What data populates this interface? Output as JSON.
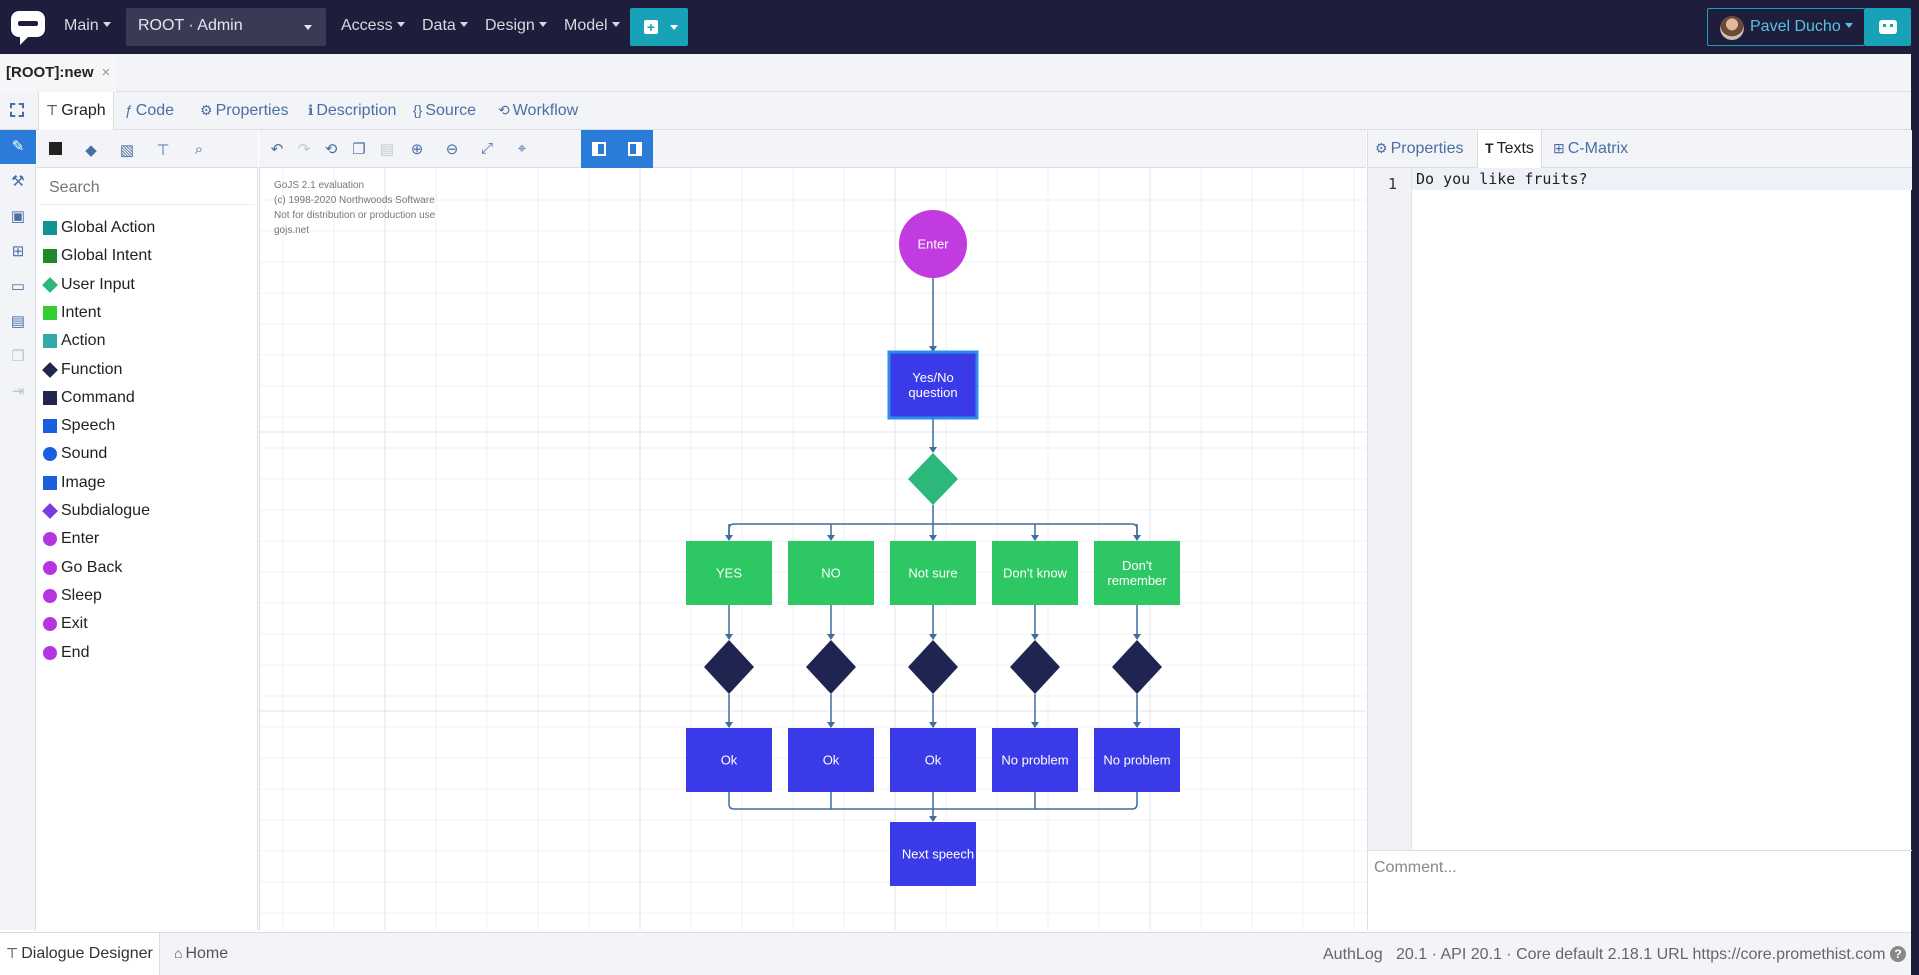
{
  "navbar": {
    "menus": [
      "Main",
      "Access",
      "Data",
      "Design",
      "Model"
    ],
    "root_selector": "ROOT · Admin",
    "user_name": "Pavel Ducho"
  },
  "file_tab": {
    "label": "[ROOT]:new",
    "close": "×"
  },
  "editor_tabs": [
    {
      "label": "Graph",
      "icon": "sitemap-icon",
      "active": true
    },
    {
      "label": "Code",
      "icon": "function-icon",
      "active": false
    },
    {
      "label": "Properties",
      "icon": "gear-icon",
      "active": false
    },
    {
      "label": "Description",
      "icon": "info-icon",
      "active": false
    },
    {
      "label": "Source",
      "icon": "braces-icon",
      "active": false
    },
    {
      "label": "Workflow",
      "icon": "retweet-icon",
      "active": false
    }
  ],
  "palette": {
    "search_placeholder": "Search",
    "items": [
      {
        "label": "Global Action",
        "shape": "square",
        "color": "#139393"
      },
      {
        "label": "Global Intent",
        "shape": "square",
        "color": "#1e8a2a"
      },
      {
        "label": "User Input",
        "shape": "diamond",
        "color": "#2cb87a"
      },
      {
        "label": "Intent",
        "shape": "square",
        "color": "#33cc33"
      },
      {
        "label": "Action",
        "shape": "square",
        "color": "#35a8a8"
      },
      {
        "label": "Function",
        "shape": "diamond",
        "color": "#22264f"
      },
      {
        "label": "Command",
        "shape": "square",
        "color": "#22264f"
      },
      {
        "label": "Speech",
        "shape": "square",
        "color": "#1a5fe0"
      },
      {
        "label": "Sound",
        "shape": "circle",
        "color": "#1a5fe0"
      },
      {
        "label": "Image",
        "shape": "square",
        "color": "#1a5fe0"
      },
      {
        "label": "Subdialogue",
        "shape": "diamond",
        "color": "#7a3ae0"
      },
      {
        "label": "Enter",
        "shape": "circle",
        "color": "#b536e0"
      },
      {
        "label": "Go Back",
        "shape": "circle",
        "color": "#b536e0"
      },
      {
        "label": "Sleep",
        "shape": "circle",
        "color": "#b536e0"
      },
      {
        "label": "Exit",
        "shape": "circle",
        "color": "#b536e0"
      },
      {
        "label": "End",
        "shape": "circle",
        "color": "#b536e0"
      }
    ]
  },
  "canvas": {
    "watermark": [
      "GoJS 2.1 evaluation",
      "(c) 1998-2020 Northwoods Software",
      "Not for distribution or production use",
      "gojs.net"
    ],
    "nodes": {
      "enter": "Enter",
      "question": [
        "Yes/No",
        "question"
      ],
      "intents": [
        [
          "YES"
        ],
        [
          "NO"
        ],
        [
          "Not sure"
        ],
        [
          "Don't know"
        ],
        [
          "Don't",
          "remember"
        ]
      ],
      "responses": [
        "Ok",
        "Ok",
        "Ok",
        "No problem",
        "No problem"
      ],
      "next": "Next speech"
    }
  },
  "right_panel": {
    "tabs": [
      {
        "label": "Properties",
        "icon": "gear-icon",
        "active": false
      },
      {
        "label": "Texts",
        "icon": "text-icon",
        "active": true
      },
      {
        "label": "C-Matrix",
        "icon": "table-icon",
        "active": false
      }
    ],
    "line_number": "1",
    "code_text": "Do you like fruits?",
    "comment_placeholder": "Comment..."
  },
  "footer": {
    "tabs": [
      {
        "label": "Dialogue Designer",
        "active": true
      },
      {
        "label": "Home",
        "active": false
      }
    ],
    "authlog": "AuthLog",
    "version": "20.1 · API 20.1 · Core default 2.18.1 URL https://core.promethist.com"
  },
  "colors": {
    "navbar": "#1e1d3b",
    "accent": "#17a2b8",
    "enter": "#c23be0",
    "speech": "#3a3ae8",
    "intent": "#2dc864",
    "user_input": "#2cb87a",
    "function": "#1f2550"
  }
}
